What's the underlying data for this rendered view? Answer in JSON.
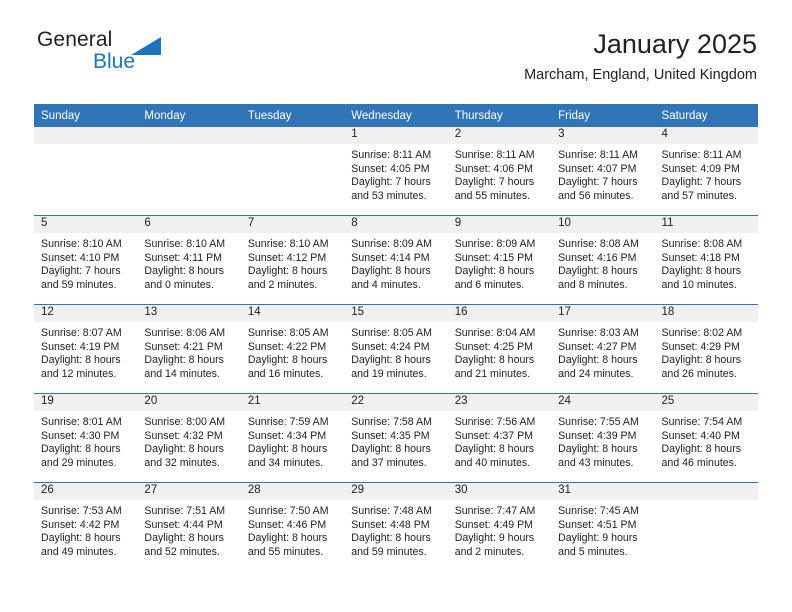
{
  "brand": {
    "name_primary": "General",
    "name_secondary": "Blue",
    "triangle_color": "#1b75bb",
    "primary_color": "#231f20"
  },
  "header": {
    "title": "January 2025",
    "location": "Marcham, England, United Kingdom"
  },
  "theme": {
    "header_bg": "#3075b8",
    "header_text": "#ffffff",
    "daynum_band_bg": "#f0f0f0",
    "row_divider": "#3075b8",
    "body_text": "#222222"
  },
  "calendar": {
    "weekday_headers": [
      "Sunday",
      "Monday",
      "Tuesday",
      "Wednesday",
      "Thursday",
      "Friday",
      "Saturday"
    ],
    "weeks": [
      [
        {
          "day": "",
          "sunrise": "",
          "sunset": "",
          "daylight_line1": "",
          "daylight_line2": ""
        },
        {
          "day": "",
          "sunrise": "",
          "sunset": "",
          "daylight_line1": "",
          "daylight_line2": ""
        },
        {
          "day": "",
          "sunrise": "",
          "sunset": "",
          "daylight_line1": "",
          "daylight_line2": ""
        },
        {
          "day": "1",
          "sunrise": "Sunrise: 8:11 AM",
          "sunset": "Sunset: 4:05 PM",
          "daylight_line1": "Daylight: 7 hours",
          "daylight_line2": "and 53 minutes."
        },
        {
          "day": "2",
          "sunrise": "Sunrise: 8:11 AM",
          "sunset": "Sunset: 4:06 PM",
          "daylight_line1": "Daylight: 7 hours",
          "daylight_line2": "and 55 minutes."
        },
        {
          "day": "3",
          "sunrise": "Sunrise: 8:11 AM",
          "sunset": "Sunset: 4:07 PM",
          "daylight_line1": "Daylight: 7 hours",
          "daylight_line2": "and 56 minutes."
        },
        {
          "day": "4",
          "sunrise": "Sunrise: 8:11 AM",
          "sunset": "Sunset: 4:09 PM",
          "daylight_line1": "Daylight: 7 hours",
          "daylight_line2": "and 57 minutes."
        }
      ],
      [
        {
          "day": "5",
          "sunrise": "Sunrise: 8:10 AM",
          "sunset": "Sunset: 4:10 PM",
          "daylight_line1": "Daylight: 7 hours",
          "daylight_line2": "and 59 minutes."
        },
        {
          "day": "6",
          "sunrise": "Sunrise: 8:10 AM",
          "sunset": "Sunset: 4:11 PM",
          "daylight_line1": "Daylight: 8 hours",
          "daylight_line2": "and 0 minutes."
        },
        {
          "day": "7",
          "sunrise": "Sunrise: 8:10 AM",
          "sunset": "Sunset: 4:12 PM",
          "daylight_line1": "Daylight: 8 hours",
          "daylight_line2": "and 2 minutes."
        },
        {
          "day": "8",
          "sunrise": "Sunrise: 8:09 AM",
          "sunset": "Sunset: 4:14 PM",
          "daylight_line1": "Daylight: 8 hours",
          "daylight_line2": "and 4 minutes."
        },
        {
          "day": "9",
          "sunrise": "Sunrise: 8:09 AM",
          "sunset": "Sunset: 4:15 PM",
          "daylight_line1": "Daylight: 8 hours",
          "daylight_line2": "and 6 minutes."
        },
        {
          "day": "10",
          "sunrise": "Sunrise: 8:08 AM",
          "sunset": "Sunset: 4:16 PM",
          "daylight_line1": "Daylight: 8 hours",
          "daylight_line2": "and 8 minutes."
        },
        {
          "day": "11",
          "sunrise": "Sunrise: 8:08 AM",
          "sunset": "Sunset: 4:18 PM",
          "daylight_line1": "Daylight: 8 hours",
          "daylight_line2": "and 10 minutes."
        }
      ],
      [
        {
          "day": "12",
          "sunrise": "Sunrise: 8:07 AM",
          "sunset": "Sunset: 4:19 PM",
          "daylight_line1": "Daylight: 8 hours",
          "daylight_line2": "and 12 minutes."
        },
        {
          "day": "13",
          "sunrise": "Sunrise: 8:06 AM",
          "sunset": "Sunset: 4:21 PM",
          "daylight_line1": "Daylight: 8 hours",
          "daylight_line2": "and 14 minutes."
        },
        {
          "day": "14",
          "sunrise": "Sunrise: 8:05 AM",
          "sunset": "Sunset: 4:22 PM",
          "daylight_line1": "Daylight: 8 hours",
          "daylight_line2": "and 16 minutes."
        },
        {
          "day": "15",
          "sunrise": "Sunrise: 8:05 AM",
          "sunset": "Sunset: 4:24 PM",
          "daylight_line1": "Daylight: 8 hours",
          "daylight_line2": "and 19 minutes."
        },
        {
          "day": "16",
          "sunrise": "Sunrise: 8:04 AM",
          "sunset": "Sunset: 4:25 PM",
          "daylight_line1": "Daylight: 8 hours",
          "daylight_line2": "and 21 minutes."
        },
        {
          "day": "17",
          "sunrise": "Sunrise: 8:03 AM",
          "sunset": "Sunset: 4:27 PM",
          "daylight_line1": "Daylight: 8 hours",
          "daylight_line2": "and 24 minutes."
        },
        {
          "day": "18",
          "sunrise": "Sunrise: 8:02 AM",
          "sunset": "Sunset: 4:29 PM",
          "daylight_line1": "Daylight: 8 hours",
          "daylight_line2": "and 26 minutes."
        }
      ],
      [
        {
          "day": "19",
          "sunrise": "Sunrise: 8:01 AM",
          "sunset": "Sunset: 4:30 PM",
          "daylight_line1": "Daylight: 8 hours",
          "daylight_line2": "and 29 minutes."
        },
        {
          "day": "20",
          "sunrise": "Sunrise: 8:00 AM",
          "sunset": "Sunset: 4:32 PM",
          "daylight_line1": "Daylight: 8 hours",
          "daylight_line2": "and 32 minutes."
        },
        {
          "day": "21",
          "sunrise": "Sunrise: 7:59 AM",
          "sunset": "Sunset: 4:34 PM",
          "daylight_line1": "Daylight: 8 hours",
          "daylight_line2": "and 34 minutes."
        },
        {
          "day": "22",
          "sunrise": "Sunrise: 7:58 AM",
          "sunset": "Sunset: 4:35 PM",
          "daylight_line1": "Daylight: 8 hours",
          "daylight_line2": "and 37 minutes."
        },
        {
          "day": "23",
          "sunrise": "Sunrise: 7:56 AM",
          "sunset": "Sunset: 4:37 PM",
          "daylight_line1": "Daylight: 8 hours",
          "daylight_line2": "and 40 minutes."
        },
        {
          "day": "24",
          "sunrise": "Sunrise: 7:55 AM",
          "sunset": "Sunset: 4:39 PM",
          "daylight_line1": "Daylight: 8 hours",
          "daylight_line2": "and 43 minutes."
        },
        {
          "day": "25",
          "sunrise": "Sunrise: 7:54 AM",
          "sunset": "Sunset: 4:40 PM",
          "daylight_line1": "Daylight: 8 hours",
          "daylight_line2": "and 46 minutes."
        }
      ],
      [
        {
          "day": "26",
          "sunrise": "Sunrise: 7:53 AM",
          "sunset": "Sunset: 4:42 PM",
          "daylight_line1": "Daylight: 8 hours",
          "daylight_line2": "and 49 minutes."
        },
        {
          "day": "27",
          "sunrise": "Sunrise: 7:51 AM",
          "sunset": "Sunset: 4:44 PM",
          "daylight_line1": "Daylight: 8 hours",
          "daylight_line2": "and 52 minutes."
        },
        {
          "day": "28",
          "sunrise": "Sunrise: 7:50 AM",
          "sunset": "Sunset: 4:46 PM",
          "daylight_line1": "Daylight: 8 hours",
          "daylight_line2": "and 55 minutes."
        },
        {
          "day": "29",
          "sunrise": "Sunrise: 7:48 AM",
          "sunset": "Sunset: 4:48 PM",
          "daylight_line1": "Daylight: 8 hours",
          "daylight_line2": "and 59 minutes."
        },
        {
          "day": "30",
          "sunrise": "Sunrise: 7:47 AM",
          "sunset": "Sunset: 4:49 PM",
          "daylight_line1": "Daylight: 9 hours",
          "daylight_line2": "and 2 minutes."
        },
        {
          "day": "31",
          "sunrise": "Sunrise: 7:45 AM",
          "sunset": "Sunset: 4:51 PM",
          "daylight_line1": "Daylight: 9 hours",
          "daylight_line2": "and 5 minutes."
        },
        {
          "day": "",
          "sunrise": "",
          "sunset": "",
          "daylight_line1": "",
          "daylight_line2": ""
        }
      ]
    ]
  }
}
